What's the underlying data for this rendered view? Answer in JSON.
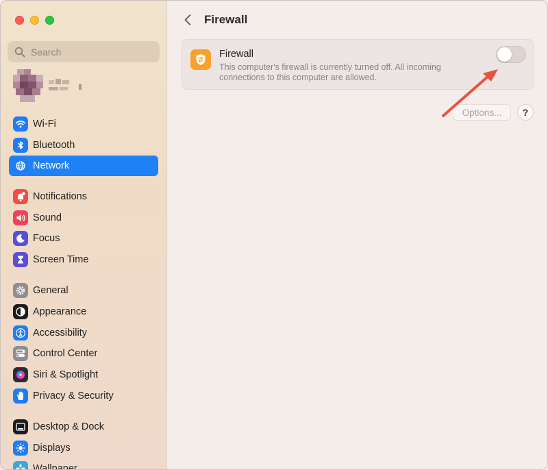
{
  "window": {
    "traffic_lights": [
      "close",
      "minimize",
      "zoom"
    ]
  },
  "search": {
    "placeholder": "Search",
    "value": ""
  },
  "sidebar": {
    "groups": [
      [
        {
          "label": "Wi-Fi",
          "icon": "wifi-icon",
          "color": "#1f7cf5",
          "selected": false
        },
        {
          "label": "Bluetooth",
          "icon": "bluetooth-icon",
          "color": "#1f7cf5",
          "selected": false
        },
        {
          "label": "Network",
          "icon": "globe-icon",
          "color": "#1f7cf5",
          "selected": true
        }
      ],
      [
        {
          "label": "Notifications",
          "icon": "bell-icon",
          "color": "#f24e43",
          "selected": false
        },
        {
          "label": "Sound",
          "icon": "speaker-icon",
          "color": "#f2405b",
          "selected": false
        },
        {
          "label": "Focus",
          "icon": "moon-icon",
          "color": "#5a4fd6",
          "selected": false
        },
        {
          "label": "Screen Time",
          "icon": "hourglass-icon",
          "color": "#5a4fd6",
          "selected": false
        }
      ],
      [
        {
          "label": "General",
          "icon": "gear-icon",
          "color": "#8e8e93",
          "selected": false
        },
        {
          "label": "Appearance",
          "icon": "appearance-icon",
          "color": "#1c1c1e",
          "selected": false
        },
        {
          "label": "Accessibility",
          "icon": "accessibility-icon",
          "color": "#1f7cf5",
          "selected": false
        },
        {
          "label": "Control Center",
          "icon": "control-center-icon",
          "color": "#8e8e93",
          "selected": false
        },
        {
          "label": "Siri & Spotlight",
          "icon": "siri-icon",
          "color": "#2c2c2e",
          "selected": false
        },
        {
          "label": "Privacy & Security",
          "icon": "hand-icon",
          "color": "#1f7cf5",
          "selected": false
        }
      ],
      [
        {
          "label": "Desktop & Dock",
          "icon": "dock-icon",
          "color": "#1c1c1e",
          "selected": false
        },
        {
          "label": "Displays",
          "icon": "sun-icon",
          "color": "#1f7cf5",
          "selected": false
        },
        {
          "label": "Wallpaper",
          "icon": "wallpaper-icon",
          "color": "#35aadc",
          "selected": false
        }
      ]
    ]
  },
  "header": {
    "title": "Firewall"
  },
  "firewall": {
    "title": "Firewall",
    "description": "This computer's firewall is currently turned off. All incoming connections to this computer are allowed.",
    "enabled": false,
    "icon": "firewall-shield-icon",
    "accent": "#f8a12b"
  },
  "buttons": {
    "options": "Options...",
    "help": "?"
  },
  "annotation": {
    "arrow_color": "#e8533f"
  }
}
